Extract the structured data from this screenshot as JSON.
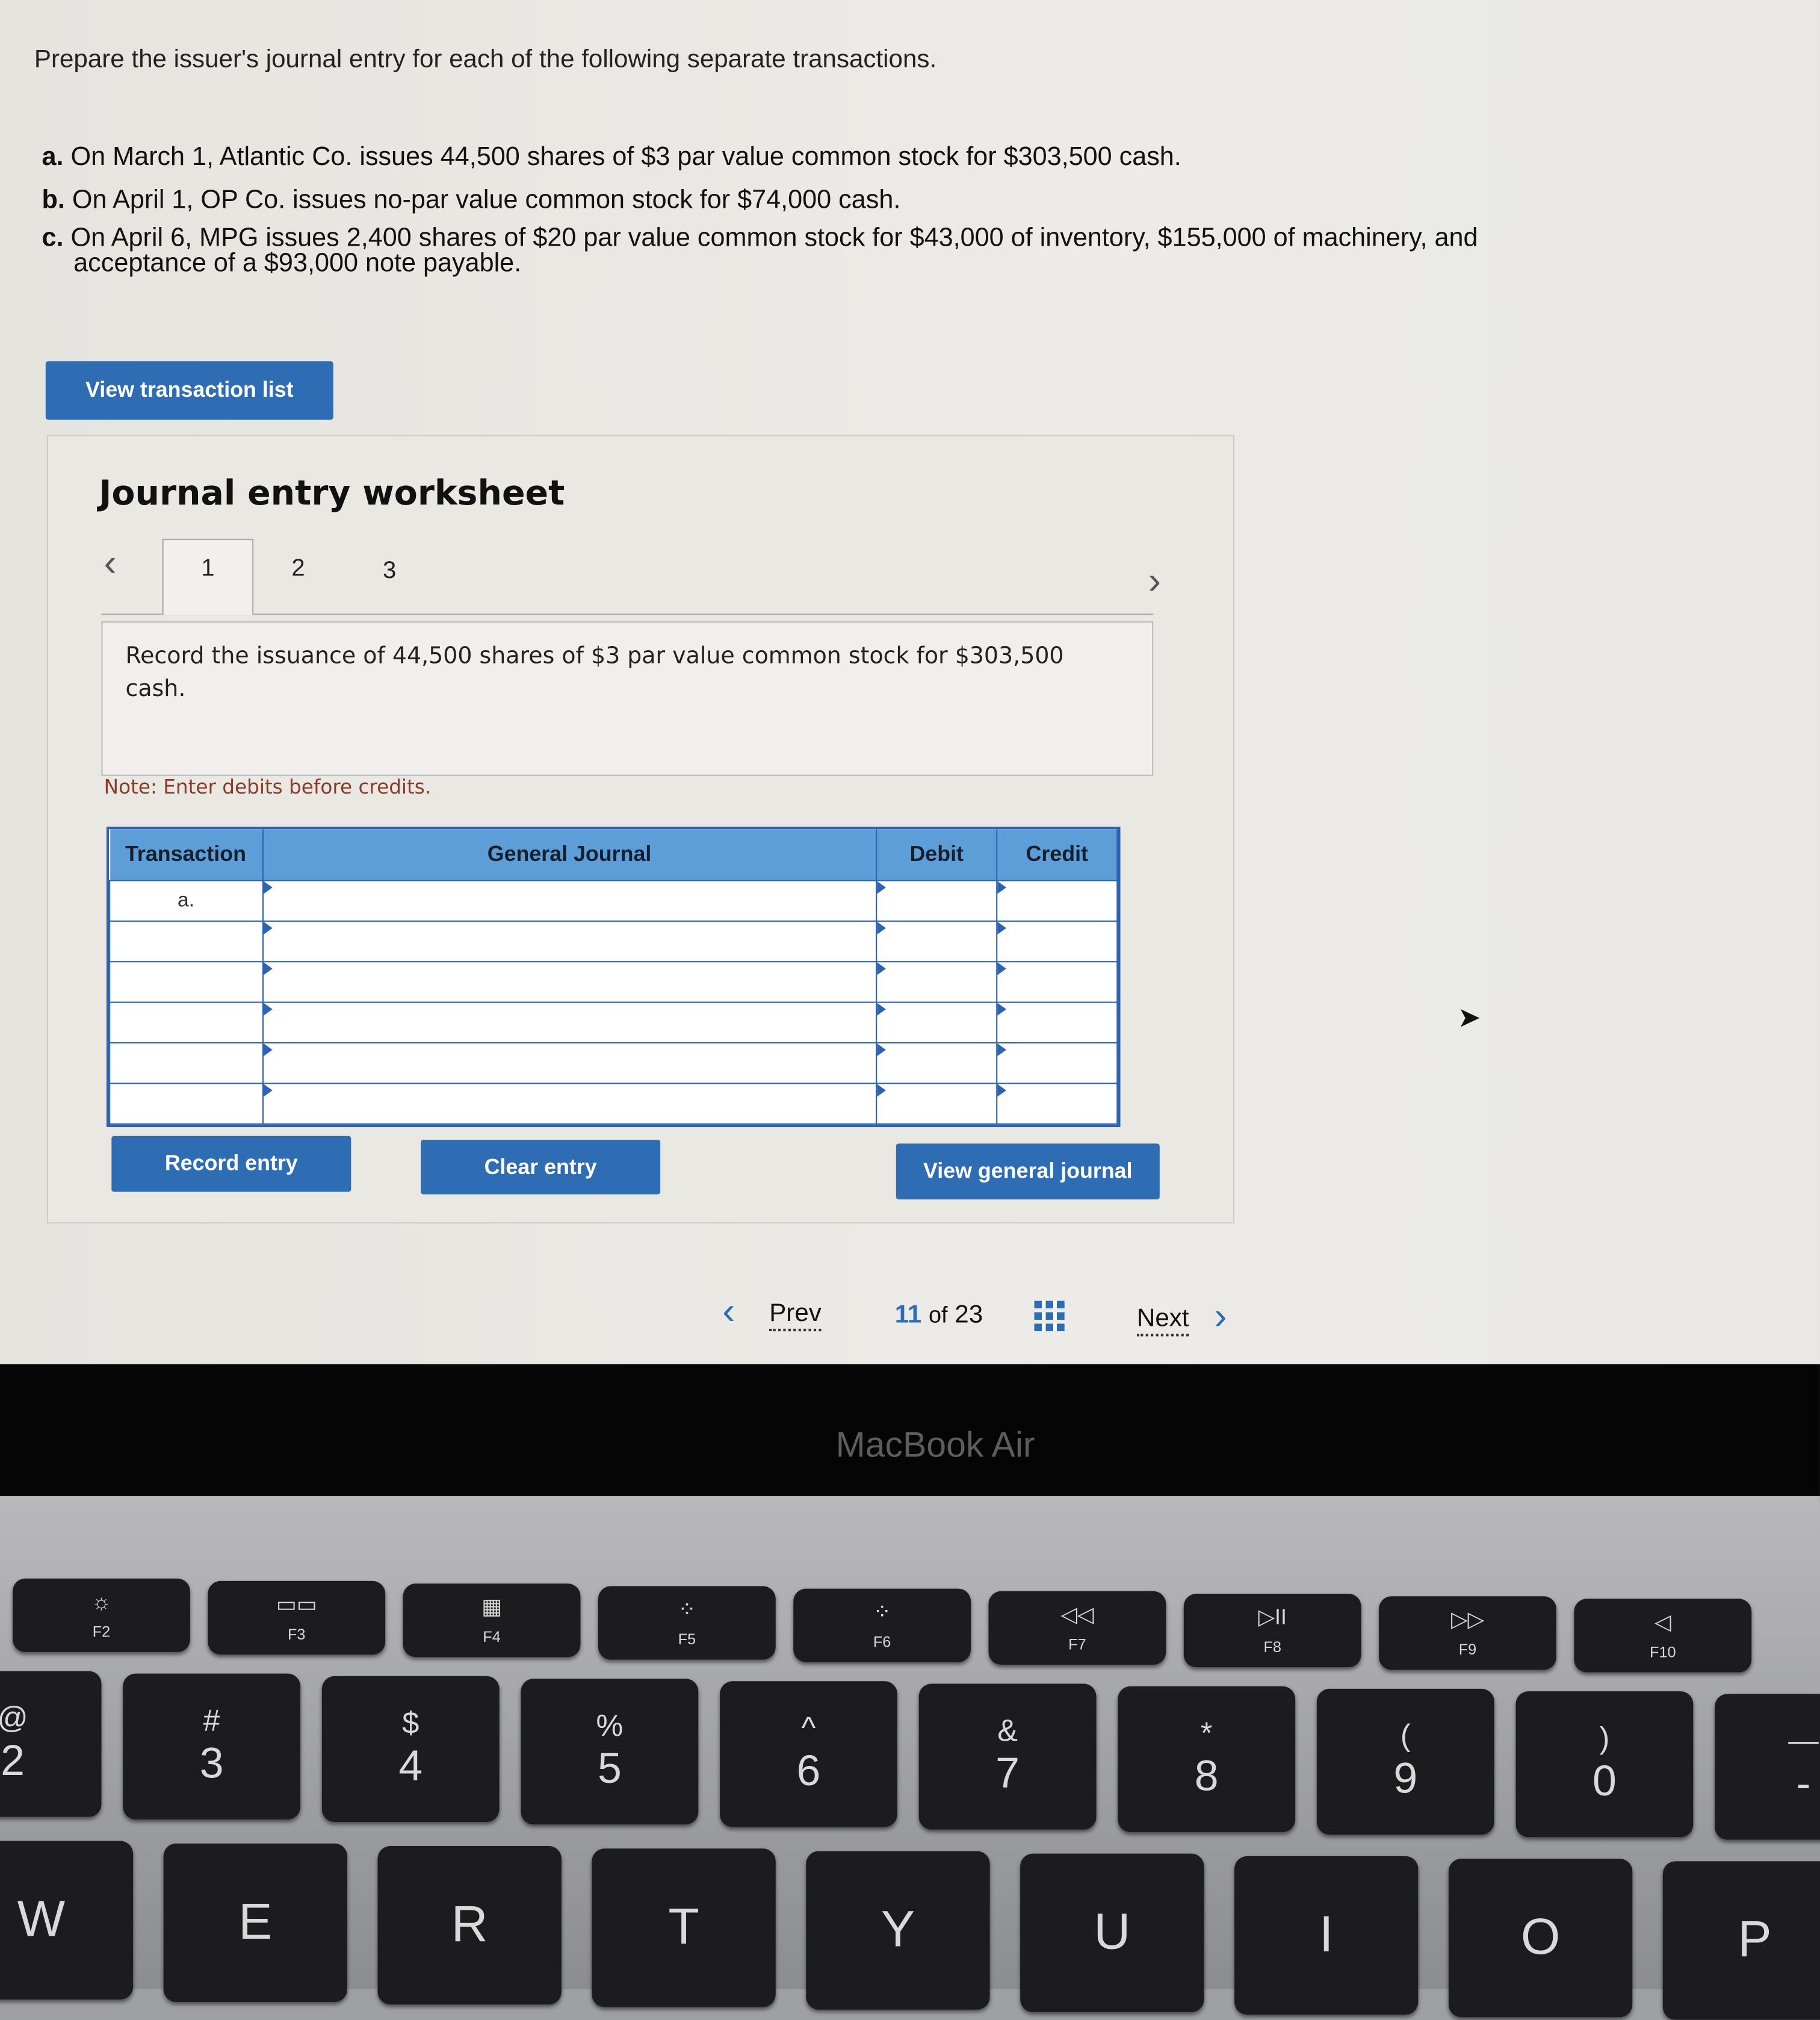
{
  "instructions": "Prepare the issuer's journal entry for each of the following separate transactions.",
  "transactions": [
    {
      "letter": "a.",
      "text": "On March 1, Atlantic Co. issues 44,500 shares of $3 par value common stock for $303,500 cash."
    },
    {
      "letter": "b.",
      "text": "On April 1, OP Co. issues no-par value common stock for $74,000 cash."
    },
    {
      "letter": "c.",
      "text": "On April 6, MPG issues 2,400 shares of $20 par value common stock for $43,000 of inventory, $155,000 of machinery, and",
      "text2": "acceptance of a $93,000 note payable."
    }
  ],
  "view_transaction_list": "View transaction list",
  "worksheet": {
    "title": "Journal entry worksheet",
    "tabs": [
      "1",
      "2",
      "3"
    ],
    "active_tab": "1",
    "description": "Record the issuance of 44,500 shares of $3 par value common stock for $303,500 cash.",
    "note": "Note: Enter debits before credits.",
    "columns": [
      "Transaction",
      "General Journal",
      "Debit",
      "Credit"
    ],
    "rows": [
      {
        "transaction": "a."
      },
      {
        "transaction": ""
      },
      {
        "transaction": ""
      },
      {
        "transaction": ""
      },
      {
        "transaction": ""
      },
      {
        "transaction": ""
      }
    ],
    "record_entry": "Record entry",
    "clear_entry": "Clear entry",
    "view_general_journal": "View general journal"
  },
  "pagination": {
    "prev": "Prev",
    "current": "11",
    "of": "of",
    "total": "23",
    "next": "Next"
  },
  "device_label": "MacBook Air",
  "keyboard": {
    "fkeys": [
      {
        "g": "☼",
        "l": "F2"
      },
      {
        "g": "▭▭",
        "l": "F3"
      },
      {
        "g": "▦",
        "l": "F4"
      },
      {
        "g": "⁘",
        "l": "F5"
      },
      {
        "g": "⁘",
        "l": "F6"
      },
      {
        "g": "◁◁",
        "l": "F7"
      },
      {
        "g": "▷II",
        "l": "F8"
      },
      {
        "g": "▷▷",
        "l": "F9"
      },
      {
        "g": "◁",
        "l": "F10"
      }
    ],
    "numkeys": [
      {
        "s": "@",
        "m": "2"
      },
      {
        "s": "#",
        "m": "3"
      },
      {
        "s": "$",
        "m": "4"
      },
      {
        "s": "%",
        "m": "5"
      },
      {
        "s": "^",
        "m": "6"
      },
      {
        "s": "&",
        "m": "7"
      },
      {
        "s": "*",
        "m": "8"
      },
      {
        "s": "(",
        "m": "9"
      },
      {
        "s": ")",
        "m": "0"
      },
      {
        "s": "—",
        "m": "-"
      }
    ],
    "letters": [
      "W",
      "E",
      "R",
      "T",
      "Y",
      "U",
      "I",
      "O",
      "P"
    ]
  },
  "colors": {
    "accent": "#2e6db3",
    "table_header": "#5e9ed8",
    "note": "#8a3b2a"
  }
}
